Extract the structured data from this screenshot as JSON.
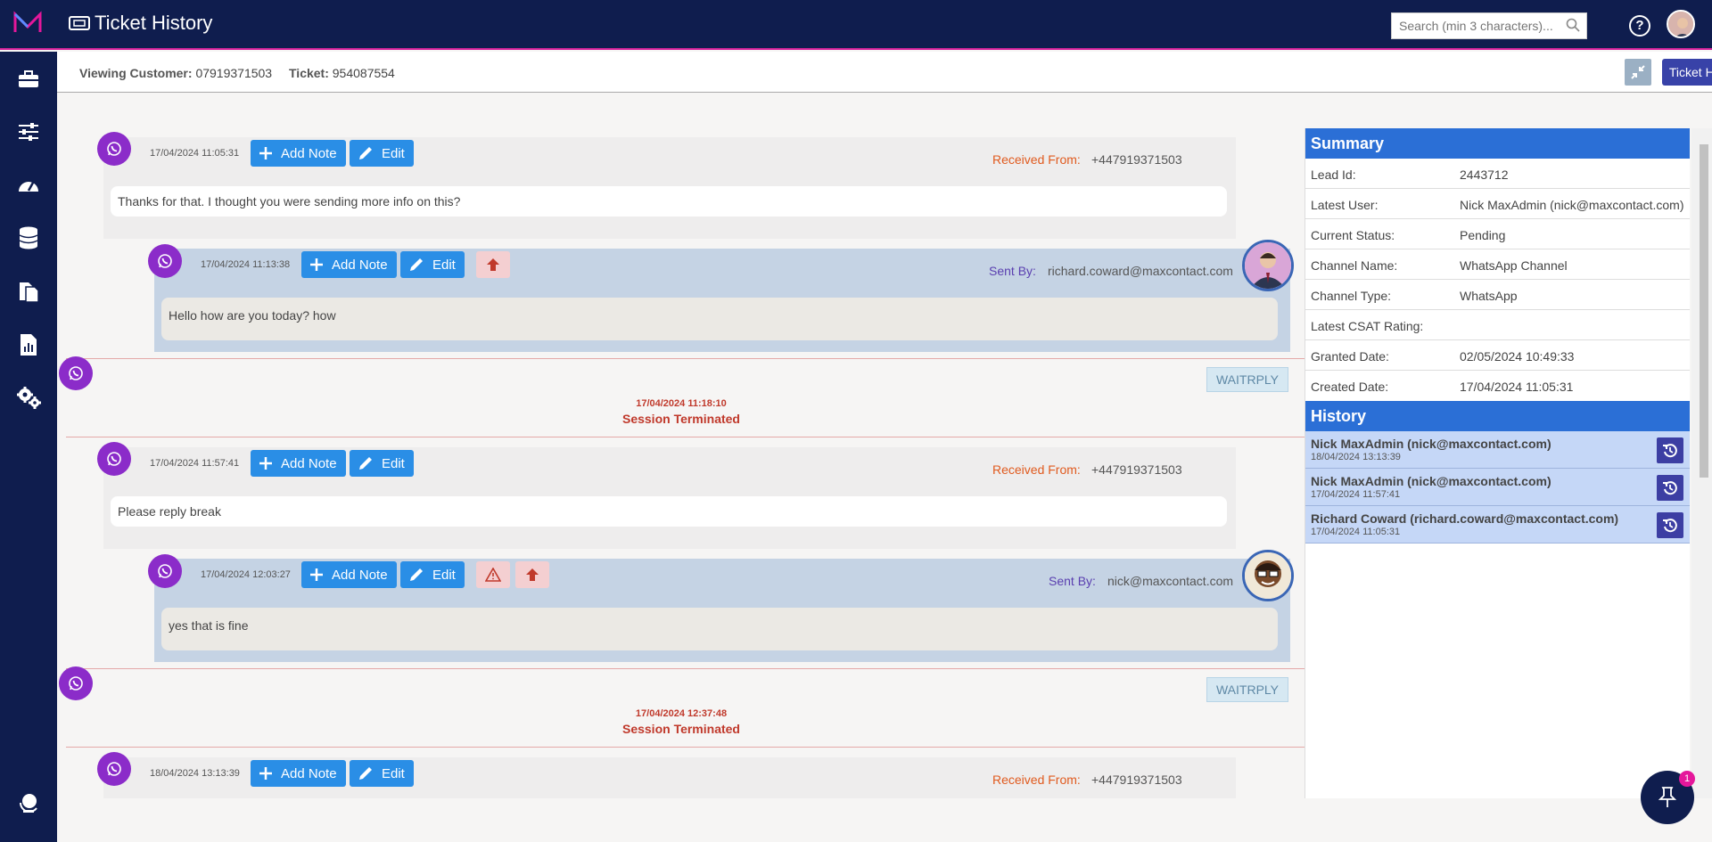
{
  "header": {
    "title": "Ticket History",
    "search_placeholder": "Search (min 3 characters)...",
    "help_label": "?"
  },
  "sidebar": {
    "items": [
      {
        "icon": "briefcase-icon"
      },
      {
        "icon": "sliders-icon"
      },
      {
        "icon": "dashboard-gauge-icon"
      },
      {
        "icon": "database-icon"
      },
      {
        "icon": "documents-icon"
      },
      {
        "icon": "report-icon"
      },
      {
        "icon": "settings-cogs-icon"
      },
      {
        "icon": "globe-icon"
      }
    ]
  },
  "subbar": {
    "customer_label": "Viewing Customer:",
    "customer_value": "07919371503",
    "ticket_label": "Ticket:",
    "ticket_value": "954087554",
    "history_button": "Ticket History"
  },
  "actions": {
    "add_note": "Add Note",
    "edit": "Edit"
  },
  "messages": [
    {
      "type": "received",
      "time": "17/04/2024 11:05:31",
      "from_label": "Received From:",
      "from": "+447919371503",
      "text": "Thanks for that. I thought you were sending more info on this?"
    },
    {
      "type": "sent",
      "time": "17/04/2024 11:13:38",
      "from_label": "Sent By:",
      "from": "richard.coward@maxcontact.com",
      "text": "Hello how are you today? how"
    },
    {
      "type": "session",
      "status": "WAITRPLY",
      "time": "17/04/2024 11:18:10",
      "text": "Session Terminated"
    },
    {
      "type": "received",
      "time": "17/04/2024 11:57:41",
      "from_label": "Received From:",
      "from": "+447919371503",
      "text": "Please reply break"
    },
    {
      "type": "sent",
      "time": "17/04/2024 12:03:27",
      "from_label": "Sent By:",
      "from": "nick@maxcontact.com",
      "text": "yes that is fine"
    },
    {
      "type": "session",
      "status": "WAITRPLY",
      "time": "17/04/2024 12:37:48",
      "text": "Session Terminated"
    },
    {
      "type": "received",
      "time": "18/04/2024 13:13:39",
      "from_label": "Received From:",
      "from": "+447919371503",
      "text": ""
    }
  ],
  "summary": {
    "title": "Summary",
    "rows": [
      {
        "label": "Lead Id:",
        "value": "2443712"
      },
      {
        "label": "Latest User:",
        "value": "Nick MaxAdmin (nick@maxcontact.com)"
      },
      {
        "label": "Current Status:",
        "value": "Pending"
      },
      {
        "label": "Channel Name:",
        "value": "WhatsApp Channel"
      },
      {
        "label": "Channel Type:",
        "value": "WhatsApp"
      },
      {
        "label": "Latest CSAT Rating:",
        "value": ""
      },
      {
        "label": "Granted Date:",
        "value": "02/05/2024 10:49:33"
      },
      {
        "label": "Created Date:",
        "value": "17/04/2024 11:05:31"
      }
    ]
  },
  "history": {
    "title": "History",
    "items": [
      {
        "name": "Nick MaxAdmin (nick@maxcontact.com)",
        "date": "18/04/2024 13:13:39"
      },
      {
        "name": "Nick MaxAdmin (nick@maxcontact.com)",
        "date": "17/04/2024 11:57:41"
      },
      {
        "name": "Richard Coward (richard.coward@maxcontact.com)",
        "date": "17/04/2024 11:05:31"
      }
    ]
  },
  "fab": {
    "badge": "1"
  },
  "colors": {
    "nav": "#0f1d4e",
    "accent": "#d6239b",
    "button": "#2a8ee6",
    "whatsapp": "#8b2cc9",
    "summary_header": "#2b6fd6"
  }
}
